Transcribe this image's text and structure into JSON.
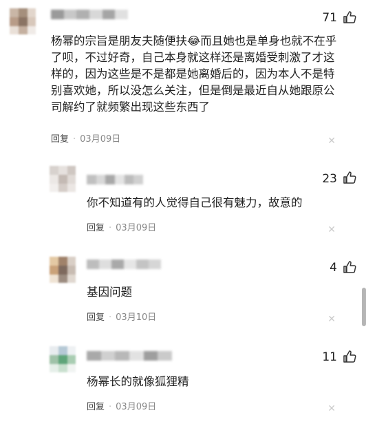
{
  "comments": [
    {
      "likes": "71",
      "text": "杨幂的宗旨是朋友夫随便扶😂而且她也是单身也就不在乎了呗，不过好奇，自己本身就这样还是离婚受刺激了才这样的，因为这些是不是都是她离婚后的，因为本人不是特别喜欢她，所以没怎么关注，但是倒是最近自从她跟原公司解约了就频繁出现这些东西了",
      "reply_label": "回复",
      "date": "03月09日",
      "avatar_colors": [
        "#c9b6a6",
        "#a58f7c",
        "#e2d6cc",
        "#b89c88",
        "#8b7464",
        "#d8c8bb",
        "#e9e0d8",
        "#c5b0a0",
        "#f0ebe7"
      ],
      "name_colors": [
        "#9a9a9a",
        "#c8c8c8",
        "#b0b0b0",
        "#d8d8d8",
        "#a5a5a5",
        "#e0e0e0"
      ]
    },
    {
      "likes": "23",
      "text": "你不知道有的人觉得自己很有魅力，故意的",
      "reply_label": "回复",
      "date": "03月09日",
      "avatar_colors": [
        "#d8d2ce",
        "#e6e1de",
        "#cfc7c2",
        "#ece8e5",
        "#c4bab4",
        "#e0dad6",
        "#f2efed",
        "#d5cdc8",
        "#ebe6e3"
      ],
      "name_colors": [
        "#c0c0c0",
        "#d8d8d8",
        "#a8a8a8",
        "#e4e4e4",
        "#bcbcbc",
        "#d0d0d0"
      ]
    },
    {
      "likes": "4",
      "text": "基因问题",
      "reply_label": "回复",
      "date": "03月10日",
      "avatar_colors": [
        "#e4c9a4",
        "#a0826a",
        "#d9cfc6",
        "#caa27a",
        "#7e6a5e",
        "#c8bcb2",
        "#efe3d4",
        "#9c8c80",
        "#e0d8d0"
      ],
      "name_colors": [
        "#bdbdbd",
        "#dedede",
        "#a9a9a9",
        "#e6e6e6",
        "#c4c4c4",
        "#d6d6d6"
      ]
    },
    {
      "likes": "11",
      "text": "杨幂长的就像狐狸精",
      "reply_label": "回复",
      "date": "03月09日",
      "avatar_colors": [
        "#e8ecef",
        "#b6c9d6",
        "#eef1f3",
        "#9fc2a8",
        "#5fa57a",
        "#a9cdb2",
        "#e6efe9",
        "#c9e0cf",
        "#f1f4f2"
      ],
      "name_colors": [
        "#a9a9a9",
        "#d0d0d0",
        "#b8b8b8",
        "#e2e2e2",
        "#9e9e9e",
        "#cacaca"
      ]
    }
  ]
}
